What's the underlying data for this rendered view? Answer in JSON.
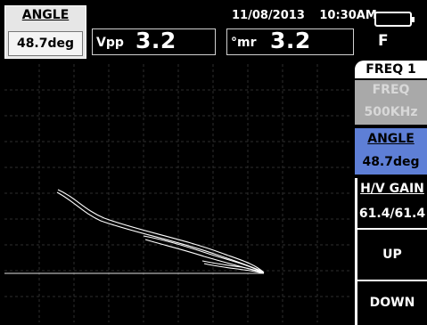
{
  "param": {
    "label": "ANGLE",
    "value": "48.7deg"
  },
  "readings": [
    {
      "label": "Vpp",
      "value": "3.2"
    },
    {
      "label": "°mr",
      "value": "3.2"
    }
  ],
  "status": {
    "date": "11/08/2013",
    "time": "10:30AM",
    "mode": "F",
    "battery_icon": "battery-icon"
  },
  "menu": {
    "freq_tab": "FREQ 1",
    "freq_label": "FREQ",
    "freq_value": "500KHz",
    "angle_label": "ANGLE",
    "angle_value": "48.7deg",
    "hv_label": "H/V GAIN",
    "hv_value": "61.4/61.4",
    "up": "UP",
    "down": "DOWN"
  },
  "colors": {
    "accent": "#5e7fd6",
    "disabled": "#a9a9a9",
    "grid": "#2e2e2e"
  }
}
